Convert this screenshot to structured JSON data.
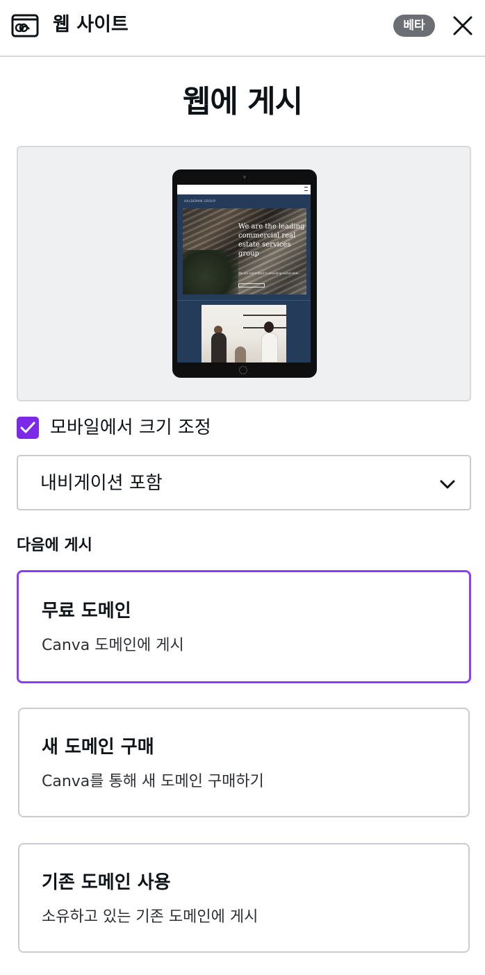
{
  "header": {
    "title": "웹 사이트",
    "badge": "베타"
  },
  "page_title": "웹에 게시",
  "preview": {
    "brand": "HALDEMAN GROUP",
    "hero_heading": "We are the leading commercial real estate services group",
    "hero_sub": "We are committed to providing sustainable..."
  },
  "resize_checkbox": {
    "label": "모바일에서 크기 조정",
    "checked": true
  },
  "navigation_select": {
    "value": "내비게이션 포함"
  },
  "publish_to_label": "다음에 게시",
  "options": [
    {
      "title": "무료 도메인",
      "description": "Canva 도메인에 게시",
      "selected": true
    },
    {
      "title": "새 도메인 구매",
      "description": "Canva를 통해 새 도메인 구매하기",
      "selected": false
    },
    {
      "title": "기존 도메인 사용",
      "description": "소유하고 있는 기존 도메인에 게시",
      "selected": false
    }
  ],
  "colors": {
    "accent": "#8b3dff",
    "checkbox": "#7d2ae8",
    "badge": "#6b6e73"
  }
}
